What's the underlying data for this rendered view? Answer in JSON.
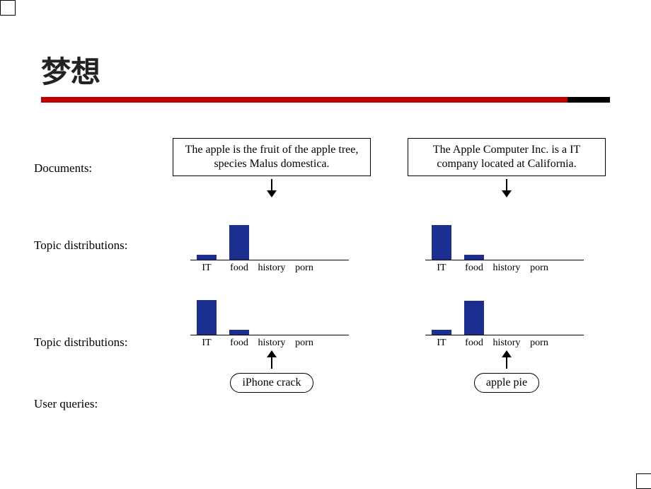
{
  "title": "梦想",
  "labels": {
    "documents": "Documents:",
    "topic_distributions": "Topic distributions:",
    "user_queries": "User queries:"
  },
  "documents": {
    "left": "The apple is the fruit of the apple tree, species Malus domestica.",
    "right": "The Apple Computer Inc. is a IT company located at California."
  },
  "queries": {
    "left": "iPhone crack",
    "right": "apple pie"
  },
  "chart_data": [
    {
      "id": "doc-left",
      "type": "bar",
      "categories": [
        "IT",
        "food",
        "history",
        "porn"
      ],
      "values": [
        0.12,
        0.88,
        0,
        0
      ],
      "ylim": [
        0,
        1
      ]
    },
    {
      "id": "doc-right",
      "type": "bar",
      "categories": [
        "IT",
        "food",
        "history",
        "porn"
      ],
      "values": [
        0.88,
        0.12,
        0,
        0
      ],
      "ylim": [
        0,
        1
      ]
    },
    {
      "id": "query-left",
      "type": "bar",
      "categories": [
        "IT",
        "food",
        "history",
        "porn"
      ],
      "values": [
        0.88,
        0.12,
        0,
        0
      ],
      "ylim": [
        0,
        1
      ]
    },
    {
      "id": "query-right",
      "type": "bar",
      "categories": [
        "IT",
        "food",
        "history",
        "porn"
      ],
      "values": [
        0.12,
        0.85,
        0,
        0
      ],
      "ylim": [
        0,
        1
      ]
    }
  ]
}
